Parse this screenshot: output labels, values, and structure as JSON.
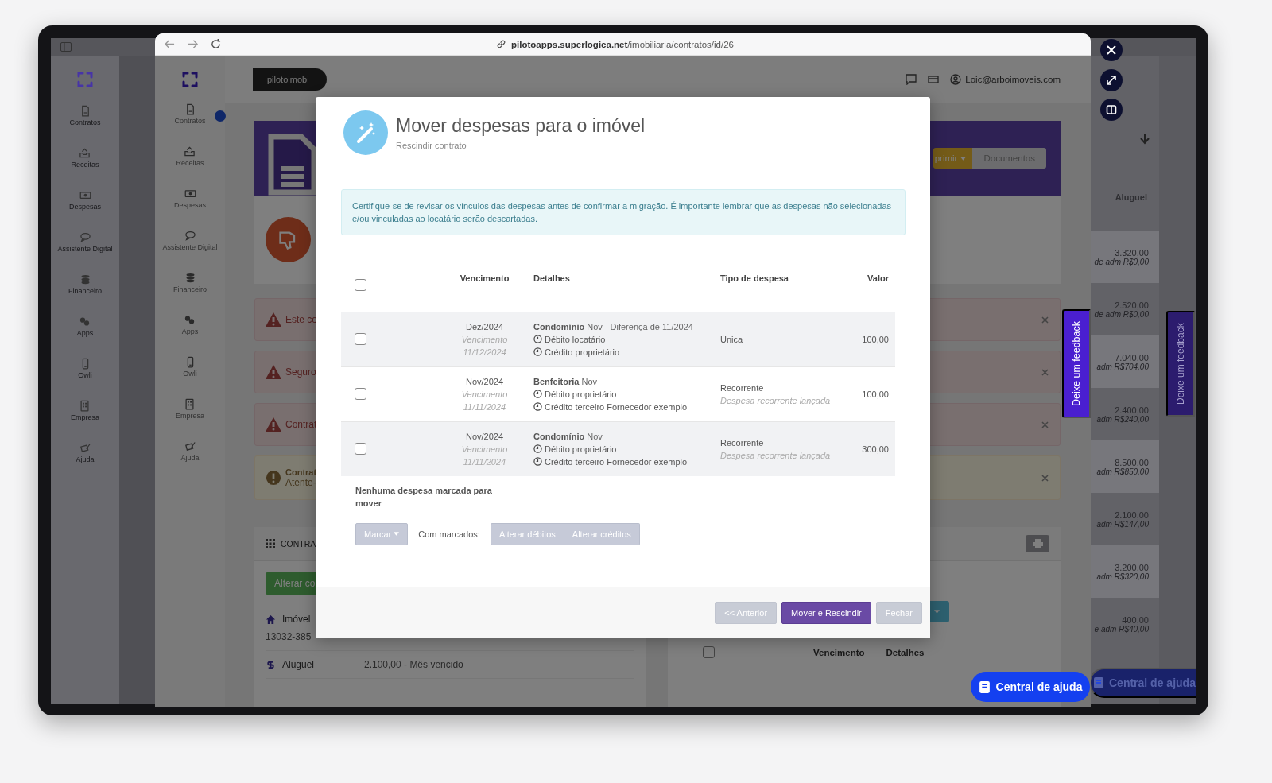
{
  "screen": {
    "sidebar": [
      {
        "label": "Contratos"
      },
      {
        "label": "Receitas"
      },
      {
        "label": "Despesas"
      },
      {
        "label": "Assistente Digital"
      },
      {
        "label": "Financeiro"
      },
      {
        "label": "Apps"
      },
      {
        "label": "Owli"
      },
      {
        "label": "Empresa"
      },
      {
        "label": "Ajuda"
      }
    ],
    "table": {
      "column": "Aluguel",
      "rows": [
        {
          "value": "3.320,00",
          "fee": "de adm R$0,00"
        },
        {
          "value": "2.520,00",
          "fee": "de adm R$0,00"
        },
        {
          "value": "7.040,00",
          "fee": "adm R$704,00"
        },
        {
          "value": "2.400,00",
          "fee": "adm R$240,00"
        },
        {
          "value": "8.500,00",
          "fee": "adm R$850,00"
        },
        {
          "value": "2.100,00",
          "fee": "adm R$147,00"
        },
        {
          "value": "3.200,00",
          "fee": "adm R$320,00"
        },
        {
          "value": "400,00",
          "fee": "e adm R$40,00"
        }
      ]
    },
    "feedback_tab": "Deixe um feedback",
    "help_button": "Central de ajuda"
  },
  "browser": {
    "url": "**pilotoapps.superlogica.net**/imobiliaria/contratos/id/26",
    "sidebar": [
      {
        "label": "Contratos"
      },
      {
        "label": "Receitas"
      },
      {
        "label": "Despesas"
      },
      {
        "label": "Assistente Digital"
      },
      {
        "label": "Financeiro"
      },
      {
        "label": "Apps"
      },
      {
        "label": "Owli"
      },
      {
        "label": "Empresa"
      },
      {
        "label": "Ajuda"
      }
    ],
    "account": "pilotoimobi",
    "user": "Loic@arboimoveis.com",
    "header_buttons": [
      {
        "label": "primir",
        "kind": "warning"
      },
      {
        "label": "Documentos",
        "kind": "default"
      }
    ],
    "alerts": [
      {
        "kind": "danger",
        "text": "Este co"
      },
      {
        "kind": "danger",
        "text": "Seguro"
      },
      {
        "kind": "danger",
        "text": "Contrat"
      },
      {
        "kind": "warning",
        "title": "Contrat",
        "text": "Atente-"
      }
    ],
    "contract_card": {
      "title": "CONTRA",
      "button": "Alterar co",
      "fields": [
        {
          "kind": "property",
          "label": "Imóvel",
          "value": "13032-385"
        },
        {
          "kind": "rent",
          "label": "Aluguel",
          "value": "2.100,00 - Mês vencido"
        }
      ]
    },
    "expenses_card": {
      "select_all": {
        "checked": false
      },
      "columns": [
        "Vencimento",
        "Detalhes"
      ]
    },
    "feedback_tab": "Deixe um feedback",
    "help_button": "Central de ajuda"
  },
  "modal": {
    "title": "Mover despesas para o imóvel",
    "subtitle": "Rescindir contrato",
    "notice": "Certifique-se de revisar os vínculos das despesas antes de confirmar a migração. É importante lembrar que as despesas não selecionadas e/ou vinculadas ao locatário serão descartadas.",
    "select_all": {
      "checked": false
    },
    "columns": [
      "Vencimento",
      "Detalhes",
      "Tipo de despesa",
      "Valor"
    ],
    "rows": [
      {
        "checked": false,
        "month": "Dez/2024",
        "due_label": "Vencimento",
        "due_date": "11/12/2024",
        "title": "**Condomínio** Nov - Diferença de 11/2024",
        "lines": [
          "Débito locatário",
          "Crédito proprietário"
        ],
        "type": "Única",
        "value": "100,00"
      },
      {
        "checked": false,
        "month": "Nov/2024",
        "due_label": "Vencimento",
        "due_date": "11/11/2024",
        "title": "**Benfeitoria** Nov",
        "lines": [
          "Débito proprietário",
          "Crédito terceiro Fornecedor exemplo"
        ],
        "type": "Recorrente",
        "type_note": "Despesa recorrente lançada",
        "value": "100,00"
      },
      {
        "checked": false,
        "month": "Nov/2024",
        "due_label": "Vencimento",
        "due_date": "11/11/2024",
        "title": "**Condomínio** Nov",
        "lines": [
          "Débito proprietário",
          "Crédito terceiro Fornecedor exemplo"
        ],
        "type": "Recorrente",
        "type_note": "Despesa recorrente lançada",
        "value": "300,00"
      }
    ],
    "empty_message": "Nenhuma despesa marcada para mover",
    "mark_button": "Marcar",
    "bulk_label": "Com marcados:",
    "bulk_buttons": [
      {
        "label": "Alterar débitos",
        "disabled": true
      },
      {
        "label": "Alterar créditos",
        "disabled": true
      }
    ],
    "footer_buttons": [
      {
        "label": "<< Anterior",
        "disabled": true
      },
      {
        "label": "Mover e Rescindir",
        "disabled": false
      },
      {
        "label": "Fechar",
        "disabled": true
      }
    ]
  }
}
